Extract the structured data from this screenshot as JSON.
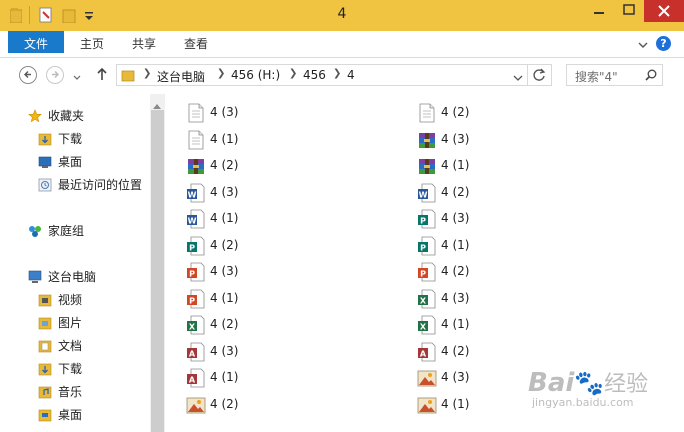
{
  "window": {
    "title": "4",
    "controls": {
      "minimize_icon": "minimize-icon",
      "maximize_icon": "maximize-icon",
      "close_icon": "close-icon"
    }
  },
  "ribbon": {
    "tabs": [
      {
        "label": "文件"
      },
      {
        "label": "主页"
      },
      {
        "label": "共享"
      },
      {
        "label": "查看"
      }
    ]
  },
  "address_bar": {
    "crumbs": [
      "这台电脑",
      "456 (H:)",
      "456",
      "4"
    ]
  },
  "search": {
    "placeholder": "搜索\"4\""
  },
  "nav_pane": {
    "favorites": "收藏夹",
    "fav_items": [
      "下载",
      "桌面",
      "最近访问的位置"
    ],
    "homegroup": "家庭组",
    "thispc": "这台电脑",
    "pc_items": [
      "视频",
      "图片",
      "文档",
      "下载",
      "音乐",
      "桌面"
    ]
  },
  "files": {
    "col1": [
      {
        "name": "4 (3)",
        "icon": "text-file-icon"
      },
      {
        "name": "4 (1)",
        "icon": "text-file-icon"
      },
      {
        "name": "4 (2)",
        "icon": "winrar-archive-icon"
      },
      {
        "name": "4 (3)",
        "icon": "word-doc-icon"
      },
      {
        "name": "4 (1)",
        "icon": "word-doc-icon"
      },
      {
        "name": "4 (2)",
        "icon": "publisher-doc-icon"
      },
      {
        "name": "4 (3)",
        "icon": "powerpoint-doc-icon"
      },
      {
        "name": "4 (1)",
        "icon": "powerpoint-doc-icon"
      },
      {
        "name": "4 (2)",
        "icon": "excel-doc-icon"
      },
      {
        "name": "4 (3)",
        "icon": "access-db-icon"
      },
      {
        "name": "4 (1)",
        "icon": "access-db-icon"
      },
      {
        "name": "4 (2)",
        "icon": "image-file-icon"
      }
    ],
    "col2": [
      {
        "name": "4 (2)",
        "icon": "text-file-icon"
      },
      {
        "name": "4 (3)",
        "icon": "winrar-archive-icon"
      },
      {
        "name": "4 (1)",
        "icon": "winrar-archive-icon"
      },
      {
        "name": "4 (2)",
        "icon": "word-doc-icon"
      },
      {
        "name": "4 (3)",
        "icon": "publisher-doc-icon"
      },
      {
        "name": "4 (1)",
        "icon": "publisher-doc-icon"
      },
      {
        "name": "4 (2)",
        "icon": "powerpoint-doc-icon"
      },
      {
        "name": "4 (3)",
        "icon": "excel-doc-icon"
      },
      {
        "name": "4 (1)",
        "icon": "excel-doc-icon"
      },
      {
        "name": "4 (2)",
        "icon": "access-db-icon"
      },
      {
        "name": "4 (3)",
        "icon": "image-file-icon"
      },
      {
        "name": "4 (1)",
        "icon": "image-file-icon"
      }
    ]
  },
  "watermark": {
    "brand": "Bai",
    "brand2": "经验",
    "url": "jingyan.baidu.com"
  },
  "colors": {
    "titlebar": "#f0c341",
    "file_tab": "#1979ca",
    "close": "#c7302b",
    "help": "#1e6fd9"
  }
}
